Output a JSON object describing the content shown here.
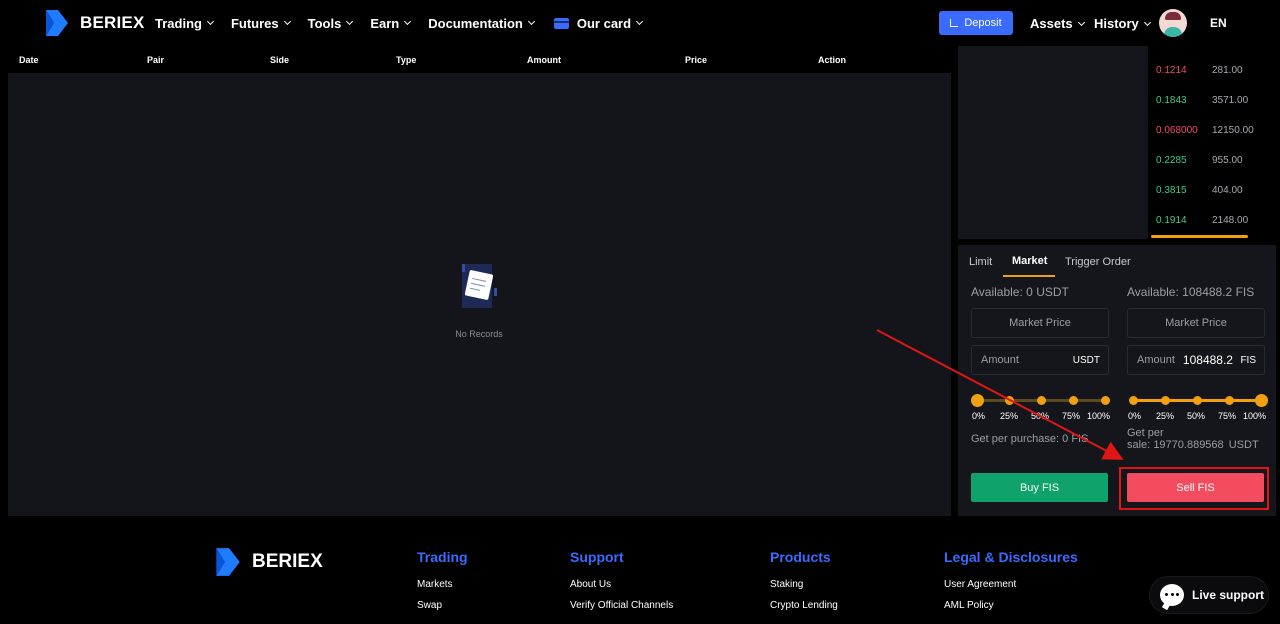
{
  "nav": {
    "brand": "BERIEX",
    "menu": [
      "Trading",
      "Futures",
      "Tools",
      "Earn",
      "Documentation"
    ],
    "card_label": "Our card",
    "deposit_label": "Deposit",
    "assets_label": "Assets",
    "history_label": "History",
    "lang_label": "EN"
  },
  "orders": {
    "columns": [
      "Date",
      "Pair",
      "Side",
      "Type",
      "Amount",
      "Price",
      "Action"
    ],
    "empty_text": "No Records"
  },
  "orderbook": {
    "rows": [
      {
        "price": "0.1214",
        "qty": "281.00",
        "dir": "down"
      },
      {
        "price": "0.1843",
        "qty": "3571.00",
        "dir": "up"
      },
      {
        "price": "0.068000",
        "qty": "12150.00",
        "dir": "down"
      },
      {
        "price": "0.2285",
        "qty": "955.00",
        "dir": "up"
      },
      {
        "price": "0.3815",
        "qty": "404.00",
        "dir": "up"
      },
      {
        "price": "0.1914",
        "qty": "2148.00",
        "dir": "up"
      }
    ]
  },
  "trade": {
    "tabs": [
      "Limit",
      "Market",
      "Trigger Order"
    ],
    "active_tab": "Market",
    "buy": {
      "available_label": "Available:",
      "available_value": "0",
      "available_unit": "USDT",
      "price_placeholder": "Market Price",
      "amount_label": "Amount",
      "amount_value": "",
      "amount_unit": "USDT",
      "slider_percent": 0,
      "get_label": "Get per purchase:",
      "get_value": "0",
      "get_unit": "FIS",
      "button_label": "Buy FIS"
    },
    "sell": {
      "available_label": "Available:",
      "available_value": "108488.2",
      "available_unit": "FIS",
      "price_placeholder": "Market Price",
      "amount_label": "Amount",
      "amount_value": "108488.2",
      "amount_unit": "FIS",
      "slider_percent": 100,
      "get_label_1": "Get per",
      "get_label_2": "sale:",
      "get_value": "19770.889568",
      "get_unit": "USDT",
      "button_label": "Sell FIS"
    },
    "slider_marks": [
      "0%",
      "25%",
      "50%",
      "75%",
      "100%"
    ]
  },
  "footer": {
    "brand": "BERIEX",
    "columns": [
      {
        "title": "Trading",
        "links": [
          "Markets",
          "Swap"
        ]
      },
      {
        "title": "Support",
        "links": [
          "About Us",
          "Verify Official Channels"
        ]
      },
      {
        "title": "Products",
        "links": [
          "Staking",
          "Crypto Lending"
        ]
      },
      {
        "title": "Legal & Disclosures",
        "links": [
          "User Agreement",
          "AML Policy"
        ]
      }
    ],
    "live_support": "Live support"
  },
  "colors": {
    "accent_blue": "#3a6bff",
    "accent_orange": "#f0a10e",
    "up_green": "#3dcc87",
    "down_red": "#f34c5f",
    "buy_green": "#0fa36b",
    "highlight_red": "#e01616"
  }
}
